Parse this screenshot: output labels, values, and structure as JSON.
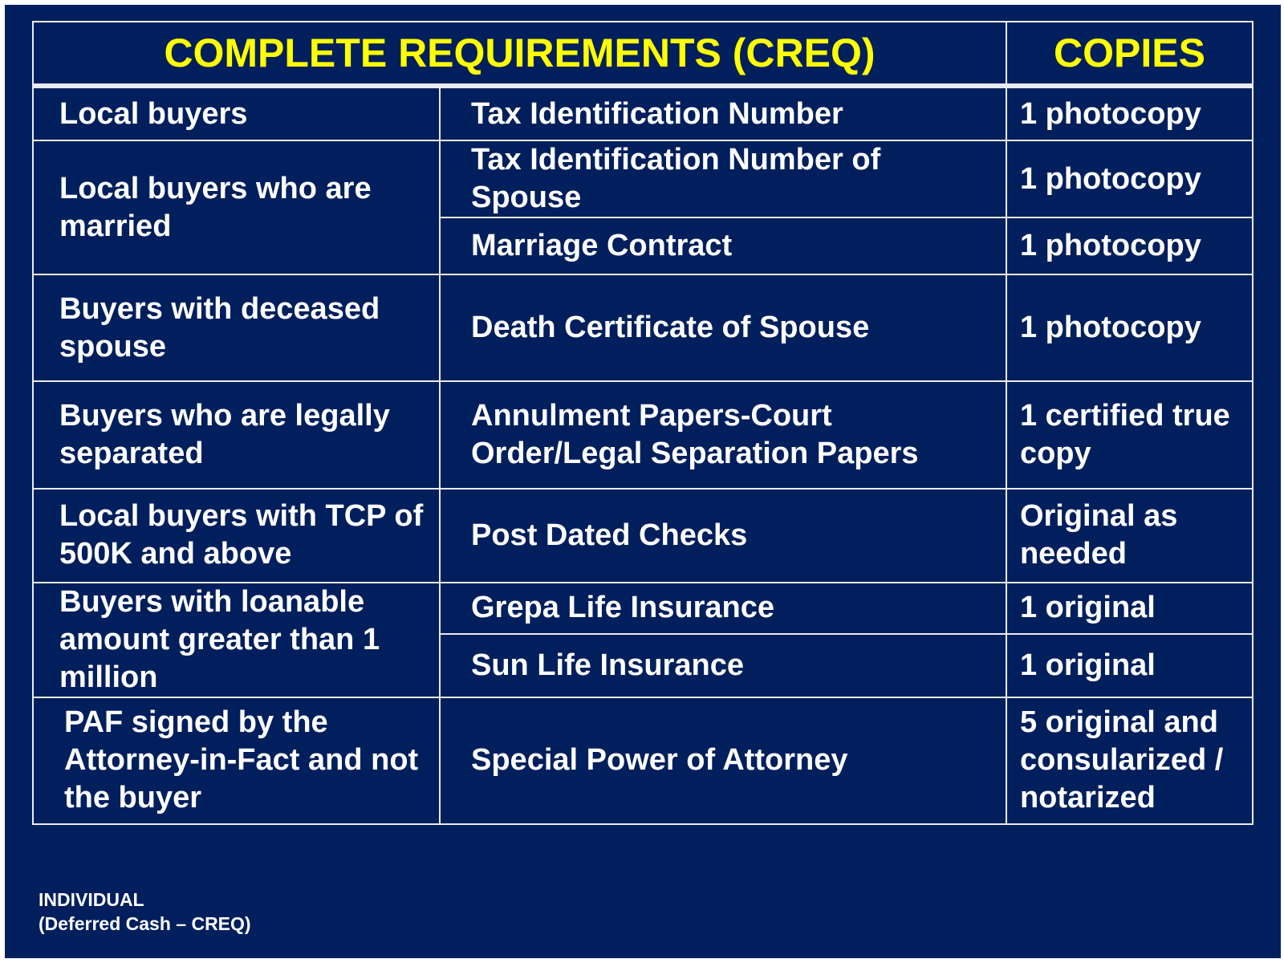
{
  "header": {
    "title": "COMPLETE REQUIREMENTS (CREQ)",
    "copies": "COPIES"
  },
  "rows": [
    {
      "who": "Local buyers",
      "doc": "Tax Identification Number",
      "copies": "1 photocopy"
    },
    {
      "who": "Local buyers who are married",
      "doc": "Tax Identification Number of Spouse",
      "copies": "1 photocopy"
    },
    {
      "doc": "Marriage Contract",
      "copies": "1 photocopy"
    },
    {
      "who": "Buyers with deceased spouse",
      "doc": "Death Certificate of Spouse",
      "copies": "1 photocopy"
    },
    {
      "who": "Buyers who are legally separated",
      "doc": "Annulment Papers-Court Order/Legal Separation Papers",
      "copies": "1 certified true copy"
    },
    {
      "who": "Local buyers with TCP of 500K and above",
      "doc": "Post Dated Checks",
      "copies": "Original as needed"
    },
    {
      "who": "Buyers with loanable amount greater than 1 million",
      "doc": "Grepa Life Insurance",
      "copies": "1 original"
    },
    {
      "doc": "Sun Life Insurance",
      "copies": "1 original"
    },
    {
      "who": "PAF signed by the Attorney-in-Fact and not the buyer",
      "doc": "Special Power of Attorney",
      "copies": "5 original and consularized / notarized"
    }
  ],
  "footer": {
    "line1": "INDIVIDUAL",
    "line2": "(Deferred Cash – CREQ)"
  },
  "colors": {
    "background": "#001f5c",
    "header_text": "#ffff00",
    "body_text": "#ffffff",
    "border": "#e8ecf5"
  }
}
